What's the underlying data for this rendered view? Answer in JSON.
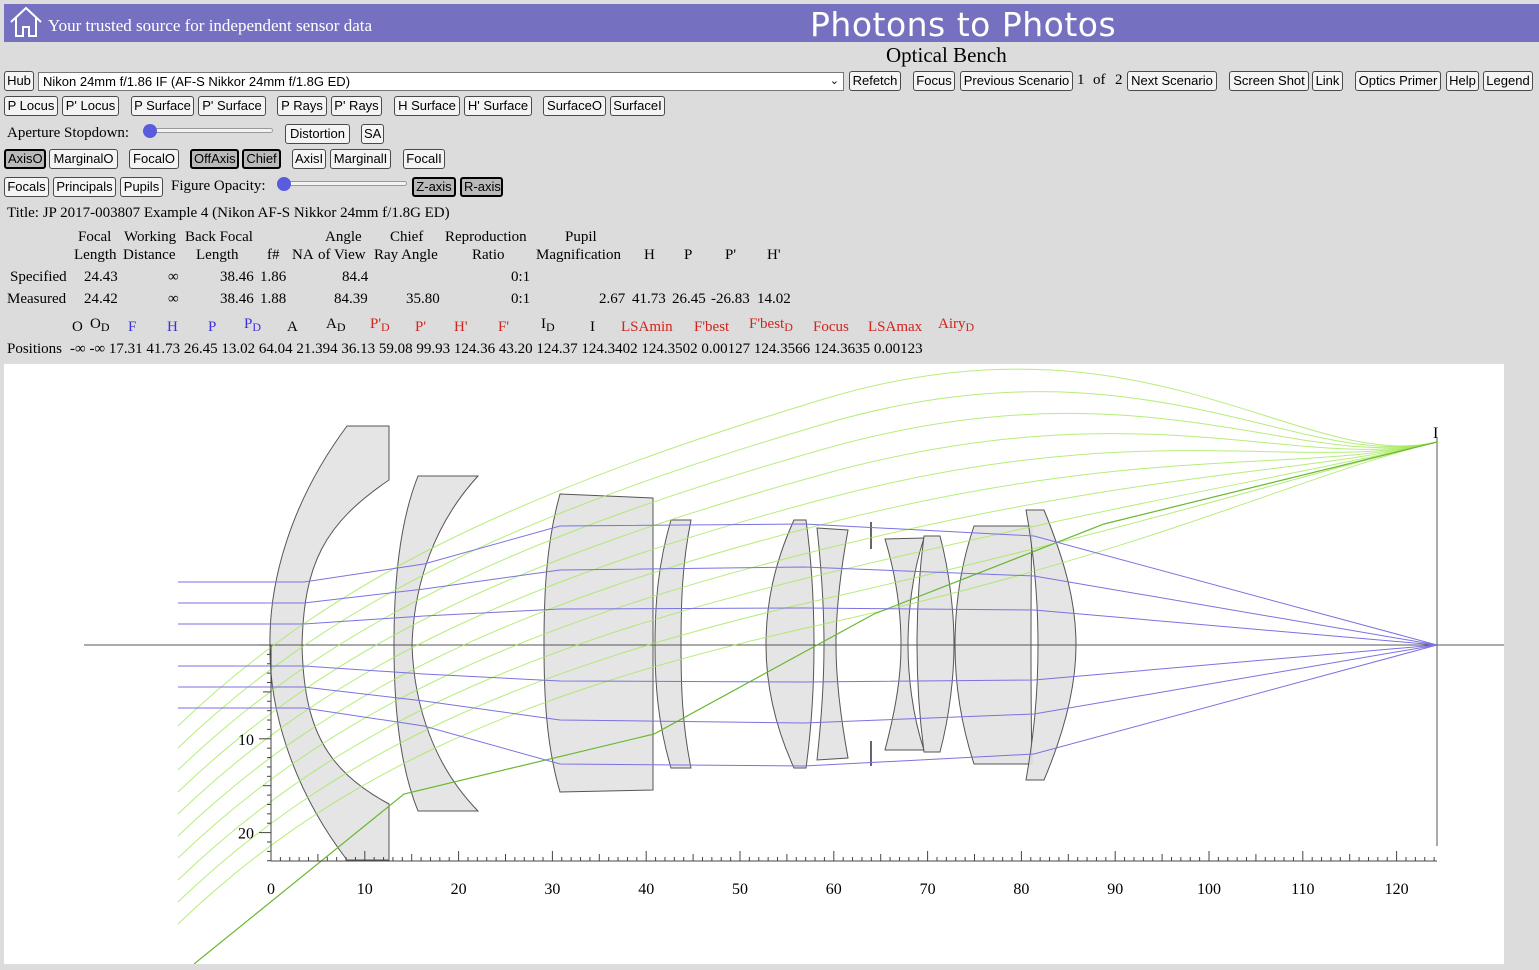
{
  "header": {
    "tagline": "Your trusted source for independent sensor data",
    "site_title": "Photons to Photos",
    "page_title": "Optical Bench"
  },
  "toolbar1": {
    "hub": "Hub",
    "lens": "Nikon 24mm f/1.86 IF (AF-S Nikkor 24mm f/1.8G ED)",
    "refetch": "Refetch",
    "focus": "Focus",
    "previous_scenario": "Previous Scenario",
    "scenario_current": "1",
    "scenario_of": "of",
    "scenario_total": "2",
    "next_scenario": "Next Scenario",
    "screen_shot": "Screen Shot",
    "link": "Link",
    "optics_primer": "Optics Primer",
    "help": "Help",
    "legend": "Legend"
  },
  "toolbar2": {
    "p_locus": "P Locus",
    "pp_locus": "P' Locus",
    "p_surface": "P Surface",
    "pp_surface": "P' Surface",
    "p_rays": "P Rays",
    "pp_rays": "P' Rays",
    "h_surface": "H Surface",
    "hp_surface": "H' Surface",
    "surface_o": "SurfaceO",
    "surface_i": "SurfaceI"
  },
  "toolbar3": {
    "aperture_label": "Aperture Stopdown:",
    "distortion": "Distortion",
    "sa": "SA"
  },
  "toolbar4": {
    "axis_o": "AxisO",
    "marginal_o": "MarginalO",
    "focal_o": "FocalO",
    "off_axis": "OffAxis",
    "chief": "Chief",
    "axis_i": "AxisI",
    "marginal_i": "MarginalI",
    "focal_i": "FocalI"
  },
  "toolbar5": {
    "focals": "Focals",
    "principals": "Principals",
    "pupils": "Pupils",
    "opacity_label": "Figure Opacity:",
    "z_axis": "Z-axis",
    "r_axis": "R-axis"
  },
  "lens_title": "Title: JP 2017-003807 Example 4 (Nikon AF-S Nikkor 24mm f/1.8G ED)",
  "specs": {
    "headers": {
      "focal_1": "Focal",
      "focal_2": "Length",
      "wd_1": "Working",
      "wd_2": "Distance",
      "bfl_1": "Back Focal",
      "bfl_2": "Length",
      "fnum": "f#",
      "na": "NA",
      "aov_1": "Angle",
      "aov_2": "of View",
      "chief_1": "Chief",
      "chief_2": "Ray Angle",
      "repro_1": "Reproduction",
      "repro_2": "Ratio",
      "pupil_1": "Pupil",
      "pupil_2": "Magnification",
      "h": "H",
      "p": "P",
      "pp": "P'",
      "hp": "H'"
    },
    "specified": {
      "label": "Specified",
      "focal": "24.43",
      "wd": "∞",
      "bfl": "38.46",
      "fnum": "1.86",
      "aov": "84.4",
      "repro": "0:1"
    },
    "measured": {
      "label": "Measured",
      "focal": "24.42",
      "wd": "∞",
      "bfl": "38.46",
      "fnum": "1.88",
      "aov": "84.39",
      "chief": "35.80",
      "repro": "0:1",
      "pupil": "2.67",
      "h": "41.73",
      "p": "26.45",
      "pp": "-26.83",
      "hp": "14.02"
    }
  },
  "positions": {
    "label": "Positions",
    "symbols": [
      {
        "main": "O",
        "sub": "",
        "color": "#000000"
      },
      {
        "main": "O",
        "sub": "D",
        "color": "#000000"
      },
      {
        "main": "F",
        "sub": "",
        "color": "#3d2fd8"
      },
      {
        "main": "H",
        "sub": "",
        "color": "#3d2fd8"
      },
      {
        "main": "P",
        "sub": "",
        "color": "#3d2fd8"
      },
      {
        "main": "P",
        "sub": "D",
        "color": "#3d2fd8"
      },
      {
        "main": "A",
        "sub": "",
        "color": "#000000"
      },
      {
        "main": "A",
        "sub": "D",
        "color": "#000000"
      },
      {
        "main": "P'",
        "sub": "D",
        "color": "#d3231d"
      },
      {
        "main": "P'",
        "sub": "",
        "color": "#d3231d"
      },
      {
        "main": "H'",
        "sub": "",
        "color": "#d3231d"
      },
      {
        "main": "F'",
        "sub": "",
        "color": "#d3231d"
      },
      {
        "main": "I",
        "sub": "D",
        "color": "#000000"
      },
      {
        "main": "I",
        "sub": "",
        "color": "#000000"
      },
      {
        "main": "LSAmin",
        "sub": "",
        "color": "#d3231d"
      },
      {
        "main": "F'best",
        "sub": "",
        "color": "#d3231d"
      },
      {
        "main": "F'best",
        "sub": "D",
        "color": "#d3231d"
      },
      {
        "main": "Focus",
        "sub": "",
        "color": "#d3231d"
      },
      {
        "main": "LSAmax",
        "sub": "",
        "color": "#d3231d"
      },
      {
        "main": "Airy",
        "sub": "D",
        "color": "#d3231d"
      }
    ],
    "values": [
      "-∞",
      "-∞",
      "17.31",
      "41.73",
      "26.45",
      "13.02",
      "64.04",
      "21.394",
      "36.13",
      "59.08",
      "99.93",
      "124.36",
      "43.20",
      "124.37",
      "124.3402",
      "124.3502",
      "0.00127",
      "124.3566",
      "124.3635",
      "0.00123"
    ]
  },
  "bench": {
    "image_label": "I",
    "z_ticks": [
      "0",
      "10",
      "20",
      "30",
      "40",
      "50",
      "60",
      "70",
      "80",
      "90",
      "100",
      "110",
      "120"
    ],
    "r_ticks": [
      "10",
      "20"
    ],
    "colors": {
      "axial_rays": "#7b72e0",
      "offaxis_rays": "#a4e85a",
      "chief_ray": "#6ab832",
      "glass": "#e2e2e2"
    }
  }
}
